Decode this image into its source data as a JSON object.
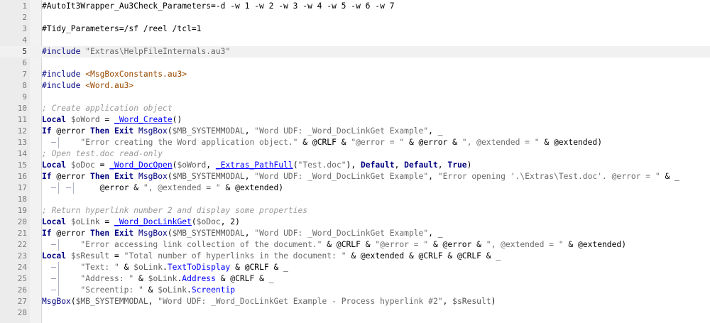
{
  "editor": {
    "current_line": 5,
    "lines": [
      {
        "n": "1",
        "tokens": [
          {
            "t": "#AutoIt3Wrapper_Au3Check_Parameters=-d -w 1 -w 2 -w 3 -w 4 -w 5 -w 6 -w 7",
            "c": "dir"
          }
        ]
      },
      {
        "n": "2",
        "tokens": []
      },
      {
        "n": "3",
        "tokens": [
          {
            "t": "#Tidy_Parameters=/sf /reel /tcl=1",
            "c": "dir"
          }
        ]
      },
      {
        "n": "4",
        "tokens": []
      },
      {
        "n": "5",
        "tokens": [
          {
            "t": "#include ",
            "c": "cmt0"
          },
          {
            "t": "\"Extras\\HelpFileInternals.au3\"",
            "c": "str"
          }
        ]
      },
      {
        "n": "6",
        "tokens": []
      },
      {
        "n": "7",
        "tokens": [
          {
            "t": "#include ",
            "c": "cmt0"
          },
          {
            "t": "<MsgBoxConstants.au3>",
            "c": "inc"
          }
        ]
      },
      {
        "n": "8",
        "tokens": [
          {
            "t": "#include ",
            "c": "cmt0"
          },
          {
            "t": "<Word.au3>",
            "c": "inc"
          }
        ]
      },
      {
        "n": "9",
        "tokens": []
      },
      {
        "n": "10",
        "tokens": [
          {
            "t": "; Create application object",
            "c": "cmt"
          }
        ]
      },
      {
        "n": "11",
        "tokens": [
          {
            "t": "Local ",
            "c": "kw"
          },
          {
            "t": "$oWord",
            "c": "var"
          },
          {
            "t": " = ",
            "c": "op"
          },
          {
            "t": "_Word_Create",
            "c": "udf"
          },
          {
            "t": "()",
            "c": "op"
          }
        ]
      },
      {
        "n": "12",
        "tokens": [
          {
            "t": "If ",
            "c": "kw"
          },
          {
            "t": "@error ",
            "c": "mac"
          },
          {
            "t": "Then Exit ",
            "c": "kw"
          },
          {
            "t": "MsgBox",
            "c": "fn"
          },
          {
            "t": "(",
            "c": "op"
          },
          {
            "t": "$MB_SYSTEMMODAL",
            "c": "var"
          },
          {
            "t": ", ",
            "c": "op"
          },
          {
            "t": "\"Word UDF: _Word_DocLinkGet Example\"",
            "c": "str"
          },
          {
            "t": ", _",
            "c": "op"
          }
        ]
      },
      {
        "n": "13",
        "fold": 1,
        "tokens": [
          {
            "t": "        \"Error creating the Word application object.\"",
            "c": "str"
          },
          {
            "t": " & ",
            "c": "op"
          },
          {
            "t": "@CRLF",
            "c": "mac"
          },
          {
            "t": " & ",
            "c": "op"
          },
          {
            "t": "\"@error = \"",
            "c": "str"
          },
          {
            "t": " & ",
            "c": "op"
          },
          {
            "t": "@error",
            "c": "mac"
          },
          {
            "t": " & ",
            "c": "op"
          },
          {
            "t": "\", @extended = \"",
            "c": "str"
          },
          {
            "t": " & ",
            "c": "op"
          },
          {
            "t": "@extended",
            "c": "mac"
          },
          {
            "t": ")",
            "c": "op"
          }
        ]
      },
      {
        "n": "14",
        "tokens": [
          {
            "t": "; Open test.doc read-only",
            "c": "cmt"
          }
        ]
      },
      {
        "n": "15",
        "tokens": [
          {
            "t": "Local ",
            "c": "kw"
          },
          {
            "t": "$oDoc",
            "c": "var"
          },
          {
            "t": " = ",
            "c": "op"
          },
          {
            "t": "_Word_DocOpen",
            "c": "udf"
          },
          {
            "t": "(",
            "c": "op"
          },
          {
            "t": "$oWord",
            "c": "var"
          },
          {
            "t": ", ",
            "c": "op"
          },
          {
            "t": "_Extras_PathFull",
            "c": "udf"
          },
          {
            "t": "(",
            "c": "op"
          },
          {
            "t": "\"Test.doc\"",
            "c": "str"
          },
          {
            "t": "), ",
            "c": "op"
          },
          {
            "t": "Default",
            "c": "kw"
          },
          {
            "t": ", ",
            "c": "op"
          },
          {
            "t": "Default",
            "c": "kw"
          },
          {
            "t": ", ",
            "c": "op"
          },
          {
            "t": "True",
            "c": "kw"
          },
          {
            "t": ")",
            "c": "op"
          }
        ]
      },
      {
        "n": "16",
        "tokens": [
          {
            "t": "If ",
            "c": "kw"
          },
          {
            "t": "@error ",
            "c": "mac"
          },
          {
            "t": "Then Exit ",
            "c": "kw"
          },
          {
            "t": "MsgBox",
            "c": "fn"
          },
          {
            "t": "(",
            "c": "op"
          },
          {
            "t": "$MB_SYSTEMMODAL",
            "c": "var"
          },
          {
            "t": ", ",
            "c": "op"
          },
          {
            "t": "\"Word UDF: _Word_DocLinkGet Example\"",
            "c": "str"
          },
          {
            "t": ", ",
            "c": "op"
          },
          {
            "t": "\"Error opening '.\\Extras\\Test.doc'. @error = \"",
            "c": "str"
          },
          {
            "t": " & _",
            "c": "op"
          }
        ]
      },
      {
        "n": "17",
        "fold": 2,
        "tokens": [
          {
            "t": "            @error",
            "c": "mac"
          },
          {
            "t": " & ",
            "c": "op"
          },
          {
            "t": "\", @extended = \"",
            "c": "str"
          },
          {
            "t": " & ",
            "c": "op"
          },
          {
            "t": "@extended",
            "c": "mac"
          },
          {
            "t": ")",
            "c": "op"
          }
        ]
      },
      {
        "n": "18",
        "tokens": []
      },
      {
        "n": "19",
        "tokens": [
          {
            "t": "; Return hyperlink number 2 and display some properties",
            "c": "cmt"
          }
        ]
      },
      {
        "n": "20",
        "tokens": [
          {
            "t": "Local ",
            "c": "kw"
          },
          {
            "t": "$oLink",
            "c": "var"
          },
          {
            "t": " = ",
            "c": "op"
          },
          {
            "t": "_Word_DocLinkGet",
            "c": "udf"
          },
          {
            "t": "(",
            "c": "op"
          },
          {
            "t": "$oDoc",
            "c": "var"
          },
          {
            "t": ", ",
            "c": "op"
          },
          {
            "t": "2",
            "c": "num"
          },
          {
            "t": ")",
            "c": "op"
          }
        ]
      },
      {
        "n": "21",
        "tokens": [
          {
            "t": "If ",
            "c": "kw"
          },
          {
            "t": "@error ",
            "c": "mac"
          },
          {
            "t": "Then Exit ",
            "c": "kw"
          },
          {
            "t": "MsgBox",
            "c": "fn"
          },
          {
            "t": "(",
            "c": "op"
          },
          {
            "t": "$MB_SYSTEMMODAL",
            "c": "var"
          },
          {
            "t": ", ",
            "c": "op"
          },
          {
            "t": "\"Word UDF: _Word_DocLinkGet Example\"",
            "c": "str"
          },
          {
            "t": ", _",
            "c": "op"
          }
        ]
      },
      {
        "n": "22",
        "fold": 1,
        "tokens": [
          {
            "t": "        \"Error accessing link collection of the document.\"",
            "c": "str"
          },
          {
            "t": " & ",
            "c": "op"
          },
          {
            "t": "@CRLF",
            "c": "mac"
          },
          {
            "t": " & ",
            "c": "op"
          },
          {
            "t": "\"@error = \"",
            "c": "str"
          },
          {
            "t": " & ",
            "c": "op"
          },
          {
            "t": "@error",
            "c": "mac"
          },
          {
            "t": " & ",
            "c": "op"
          },
          {
            "t": "\", @extended = \"",
            "c": "str"
          },
          {
            "t": " & ",
            "c": "op"
          },
          {
            "t": "@extended",
            "c": "mac"
          },
          {
            "t": ")",
            "c": "op"
          }
        ]
      },
      {
        "n": "23",
        "tokens": [
          {
            "t": "Local ",
            "c": "kw"
          },
          {
            "t": "$sResult",
            "c": "var"
          },
          {
            "t": " = ",
            "c": "op"
          },
          {
            "t": "\"Total number of hyperlinks in the document: \"",
            "c": "str"
          },
          {
            "t": " & ",
            "c": "op"
          },
          {
            "t": "@extended",
            "c": "mac"
          },
          {
            "t": " & ",
            "c": "op"
          },
          {
            "t": "@CRLF",
            "c": "mac"
          },
          {
            "t": " & ",
            "c": "op"
          },
          {
            "t": "@CRLF",
            "c": "mac"
          },
          {
            "t": " & _",
            "c": "op"
          }
        ]
      },
      {
        "n": "24",
        "fold": 1,
        "tokens": [
          {
            "t": "        \"Text: \"",
            "c": "str"
          },
          {
            "t": " & ",
            "c": "op"
          },
          {
            "t": "$oLink",
            "c": "var"
          },
          {
            "t": ".",
            "c": "op"
          },
          {
            "t": "TextToDisplay",
            "c": "prop"
          },
          {
            "t": " & ",
            "c": "op"
          },
          {
            "t": "@CRLF",
            "c": "mac"
          },
          {
            "t": " & _",
            "c": "op"
          }
        ]
      },
      {
        "n": "25",
        "fold": 1,
        "tokens": [
          {
            "t": "        \"Address: \"",
            "c": "str"
          },
          {
            "t": " & ",
            "c": "op"
          },
          {
            "t": "$oLink",
            "c": "var"
          },
          {
            "t": ".",
            "c": "op"
          },
          {
            "t": "Address",
            "c": "prop"
          },
          {
            "t": " & ",
            "c": "op"
          },
          {
            "t": "@CRLF",
            "c": "mac"
          },
          {
            "t": " & _",
            "c": "op"
          }
        ]
      },
      {
        "n": "26",
        "fold": 1,
        "tokens": [
          {
            "t": "        \"Screentip: \"",
            "c": "str"
          },
          {
            "t": " & ",
            "c": "op"
          },
          {
            "t": "$oLink",
            "c": "var"
          },
          {
            "t": ".",
            "c": "op"
          },
          {
            "t": "Screentip",
            "c": "prop"
          }
        ]
      },
      {
        "n": "27",
        "tokens": [
          {
            "t": "MsgBox",
            "c": "fn"
          },
          {
            "t": "(",
            "c": "op"
          },
          {
            "t": "$MB_SYSTEMMODAL",
            "c": "var"
          },
          {
            "t": ", ",
            "c": "op"
          },
          {
            "t": "\"Word UDF: _Word_DocLinkGet Example - Process hyperlink #2\"",
            "c": "str"
          },
          {
            "t": ", ",
            "c": "op"
          },
          {
            "t": "$sResult",
            "c": "var"
          },
          {
            "t": ")",
            "c": "op"
          }
        ]
      },
      {
        "n": "28",
        "tokens": []
      }
    ]
  }
}
